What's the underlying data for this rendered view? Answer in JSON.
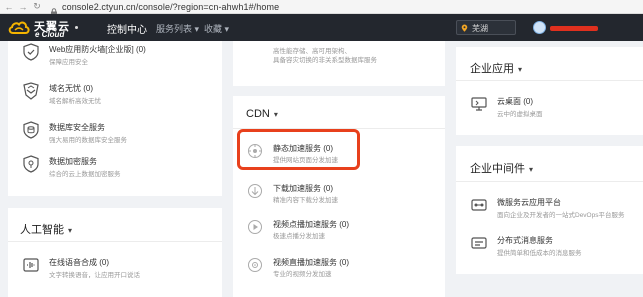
{
  "browser": {
    "url": "console2.ctyun.cn/console/?region=cn-ahwh1#/home"
  },
  "topnav": {
    "logo_name": "天翼云",
    "logo_sub": "e Cloud",
    "console": "控制中心",
    "services": "服务列表 ▾",
    "favorites": "收藏 ▾",
    "region": "芜湖"
  },
  "left": {
    "items": [
      {
        "title": "Web应用防火墙[企业版] (0)",
        "desc": "保障应用安全",
        "icon": "shield-check-icon"
      },
      {
        "title": "域名无忧 (0)",
        "desc": "域名解析高效无忧",
        "icon": "shield-globe-icon"
      },
      {
        "title": "数据库安全服务",
        "desc": "强大易用的数据库安全服务",
        "icon": "shield-db-icon"
      },
      {
        "title": "数据加密服务",
        "desc": "综合的云上数据加密服务",
        "icon": "shield-key-icon"
      }
    ],
    "ai_section": "人工智能",
    "ai_items": [
      {
        "title": "在线语音合成 (0)",
        "desc": "文字转换语音，让应用开口说话",
        "icon": "voice-icon"
      }
    ]
  },
  "middle": {
    "top_desc_1": "高性能存储、高可用架构、",
    "top_desc_2": "具备容灾切换的非关系型数据库服务",
    "cdn_section": "CDN",
    "cdn_items": [
      {
        "title": "静态加速服务 (0)",
        "desc": "提供网站页面分发加速",
        "icon": "cdn-static-icon"
      },
      {
        "title": "下载加速服务 (0)",
        "desc": "精准内容下载分发加速",
        "icon": "cdn-download-icon"
      },
      {
        "title": "视频点播加速服务 (0)",
        "desc": "极速点播分发加速",
        "icon": "cdn-vod-icon"
      },
      {
        "title": "视频直播加速服务 (0)",
        "desc": "专业的视频分发加速",
        "icon": "cdn-live-icon"
      }
    ]
  },
  "right": {
    "app_section": "企业应用",
    "app_items": [
      {
        "title": "云桌面 (0)",
        "desc": "云中的虚拟桌面",
        "icon": "desktop-icon"
      }
    ],
    "mw_section": "企业中间件",
    "mw_items": [
      {
        "title": "微服务云应用平台",
        "desc": "面向企业及开发者的一站式DevOps平台服务",
        "icon": "microservice-icon"
      },
      {
        "title": "分布式消息服务",
        "desc": "提供简单和低成本的消息服务",
        "icon": "message-icon"
      }
    ]
  }
}
